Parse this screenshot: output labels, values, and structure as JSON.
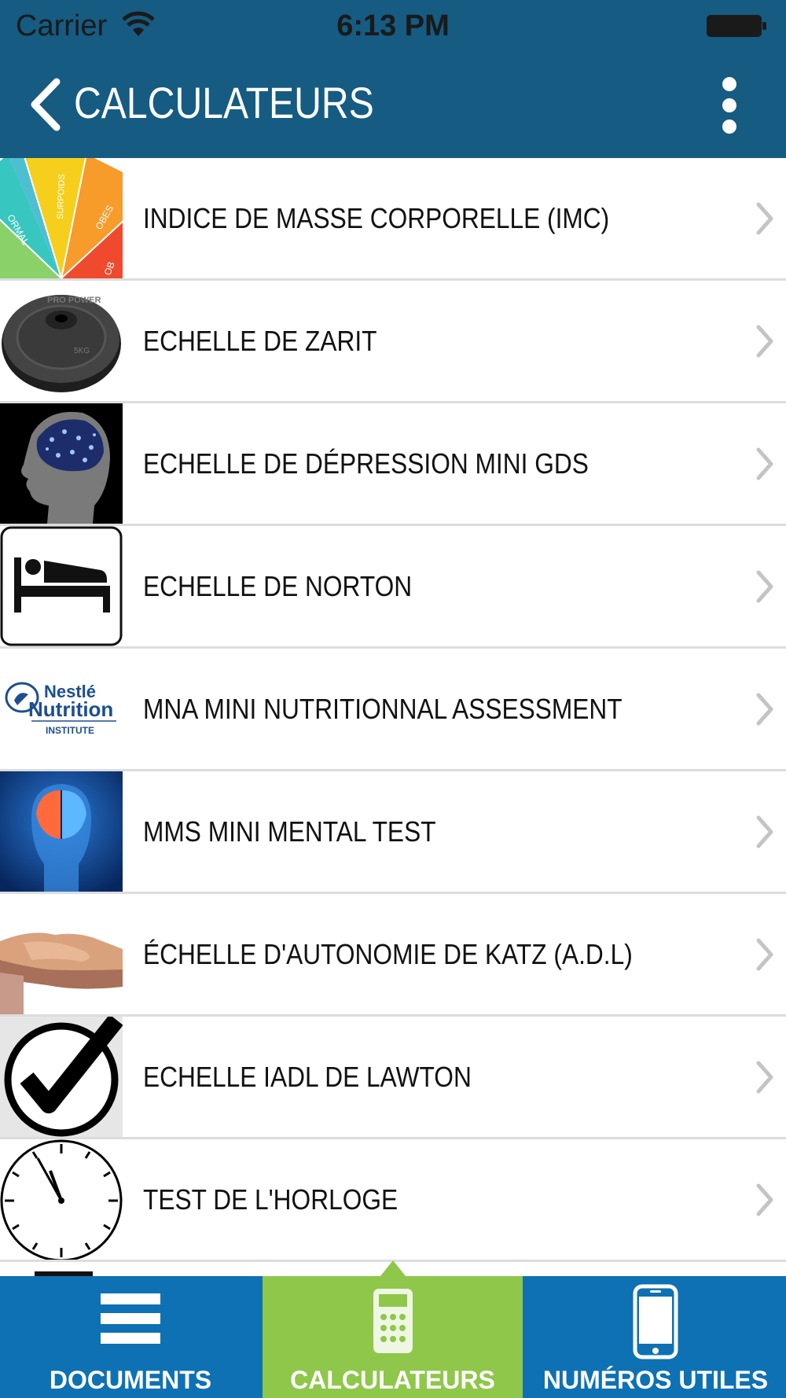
{
  "status_bar": {
    "carrier": "Carrier",
    "time": "6:13 PM"
  },
  "nav": {
    "title": "CALCULATEURS"
  },
  "items": [
    {
      "label": "INDICE DE MASSE CORPORELLE (IMC)",
      "thumb": "bmi-scale-icon",
      "thumb_text": [
        "ORMAL",
        "SURPOIDS",
        "OBES",
        "OB"
      ]
    },
    {
      "label": "ECHELLE DE ZARIT",
      "thumb": "weight-plate-icon",
      "thumb_text": [
        "PRO POWER",
        "5KG"
      ]
    },
    {
      "label": "ECHELLE DE DÉPRESSION MINI GDS",
      "thumb": "brain-head-icon"
    },
    {
      "label": "ECHELLE DE NORTON",
      "thumb": "bed-icon"
    },
    {
      "label": "MNA MINI NUTRITIONNAL ASSESSMENT",
      "thumb": "nestle-nutrition-logo",
      "thumb_text": [
        "Nestlé",
        "Nutrition",
        "INSTITUTE"
      ]
    },
    {
      "label": "MMS MINI MENTAL TEST",
      "thumb": "brain-scan-icon"
    },
    {
      "label": " ÉCHELLE D'AUTONOMIE DE KATZ (A.D.L)",
      "thumb": "handshake-icon"
    },
    {
      "label": "ECHELLE IADL DE LAWTON",
      "thumb": "checkmark-icon"
    },
    {
      "label": "TEST DE L'HORLOGE",
      "thumb": "clock-icon"
    }
  ],
  "tabs": [
    {
      "label": "DOCUMENTS",
      "icon": "menu-icon",
      "active": false
    },
    {
      "label": "CALCULATEURS",
      "icon": "calculator-icon",
      "active": true
    },
    {
      "label": "NUMÉROS UTILES",
      "icon": "phone-icon",
      "active": false
    }
  ],
  "colors": {
    "header": "#155b82",
    "tabbar": "#0e71b3",
    "active_tab": "#8fc74a"
  }
}
